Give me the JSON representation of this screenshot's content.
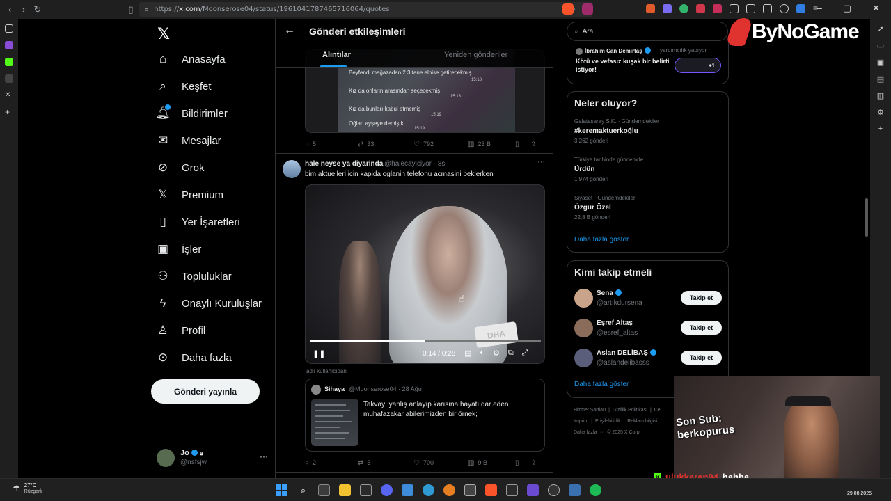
{
  "browser": {
    "url_prefix": "https://",
    "url_domain": "x.com",
    "url_path": "/Moonserose04/status/1961041787465716064/quotes"
  },
  "nav": {
    "items": [
      {
        "label": "Anasayfa",
        "icon": "home-icon"
      },
      {
        "label": "Keşfet",
        "icon": "search-icon"
      },
      {
        "label": "Bildirimler",
        "icon": "bell-icon"
      },
      {
        "label": "Mesajlar",
        "icon": "mail-icon"
      },
      {
        "label": "Grok",
        "icon": "grok-icon"
      },
      {
        "label": "Premium",
        "icon": "x-icon"
      },
      {
        "label": "Yer İşaretleri",
        "icon": "bookmark-icon"
      },
      {
        "label": "İşler",
        "icon": "briefcase-icon"
      },
      {
        "label": "Topluluklar",
        "icon": "people-icon"
      },
      {
        "label": "Onaylı Kuruluşlar",
        "icon": "lightning-icon"
      },
      {
        "label": "Profil",
        "icon": "person-icon"
      },
      {
        "label": "Daha fazla",
        "icon": "more-circle-icon"
      }
    ],
    "post_button": "Gönderi yayınla",
    "account": {
      "name": "Jo",
      "handle": "@nsfsjw"
    }
  },
  "center": {
    "title": "Gönderi etkileşimleri",
    "tabs": [
      "Alıntılar",
      "Yeniden gönderiler"
    ],
    "tweet1": {
      "chat_lines": [
        {
          "text": "Beyfendi mağazadan 2 3 tane elbise getirecekmiş",
          "time": "15:18"
        },
        {
          "text": "Kız da onların arasından seçecekmiş",
          "time": "15:18"
        },
        {
          "text": "Kız da bunları kabul etmemiş",
          "time": "15:19"
        },
        {
          "text": "Oğlan ayşeye demiş ki",
          "time": "15:19"
        }
      ],
      "stats": {
        "replies": "5",
        "reposts": "33",
        "likes": "792",
        "views": "23 B"
      }
    },
    "tweet2": {
      "name": "hale neyse ya diyarinda",
      "handle": "@halecayiciyor · 8s",
      "text": "bim aktuelleri icin kapida oglanin telefonu acmasini beklerken",
      "video_time": "0:14 / 0:28",
      "video_progress": 0.5,
      "media_caption": "adlı kullanıcıdan",
      "quote": {
        "name": "Sihaya",
        "handle": "@Moonserose04 · 28 Ağu",
        "text": "Takvayı yanlış anlayıp karısına hayatı dar eden muhafazakar abilerimizden bir örnek;"
      },
      "stats": {
        "replies": "2",
        "reposts": "5",
        "likes": "700",
        "views": "9 B"
      }
    }
  },
  "right": {
    "search_placeholder": "Ara",
    "promo": {
      "name": "İbrahim Can Demirtaş",
      "sub": "yardımcılık yapıyor",
      "text": "Kötü ve vefasız kuşak bir belirti istiyor!",
      "pill": "+1"
    },
    "trends": {
      "title": "Neler oluyor?",
      "items": [
        {
          "meta": "Galatasaray S.K. · Gündemdekiler",
          "name": "#keremaktuerkoğlu",
          "count": "3.262 gönderi"
        },
        {
          "meta": "Türkiye tarihinde gündemde",
          "name": "Ürdün",
          "count": "1.974 gönderi"
        },
        {
          "meta": "Siyaset · Gündemdekiler",
          "name": "Özgür Özel",
          "count": "22,8 B gönderi"
        }
      ],
      "show_more": "Daha fazla göster"
    },
    "who_to_follow": {
      "title": "Kimi takip etmeli",
      "items": [
        {
          "name": "Sena",
          "handle": "@artıkdursena",
          "button": "Takip et",
          "color": "#c9a48a"
        },
        {
          "name": "Eşref Altaş",
          "handle": "@esref_altas",
          "button": "Takip et",
          "color": "#8a6c5a"
        },
        {
          "name": "Aslan DELİBAŞ",
          "handle": "@aslandelibasss",
          "button": "Takip et",
          "color": "#5a5e7a"
        }
      ],
      "show_more": "Daha fazla göster"
    },
    "footer": {
      "links": [
        "Hizmet Şartları",
        "Gizlilik Politikası",
        "Çe",
        "Imprint",
        "Erişilebilirlik",
        "Reklam bilgisi",
        "Daha fazla ···",
        "© 2025 X Corp."
      ]
    }
  },
  "overlay": {
    "brand": "ByNoGame",
    "sub_alert_line1": "Son Sub:",
    "sub_alert_line2": "berkopurus",
    "chat_user": "ulukkaran94",
    "chat_text": "hahha"
  },
  "taskbar": {
    "temp": "27°C",
    "weather": "Rüzgarlı",
    "date": "29.08.2025"
  },
  "colors": {
    "accent": "#1d9bf0",
    "brand_red": "#e0332f",
    "kick_green": "#53fc18"
  }
}
